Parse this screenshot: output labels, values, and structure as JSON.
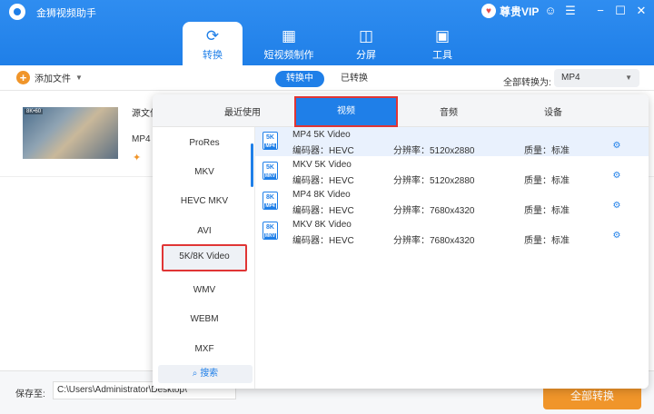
{
  "app": {
    "title": "金狮视频助手",
    "vip_label": "尊贵VIP"
  },
  "nav": {
    "tabs": [
      {
        "label": "转换",
        "icon": "convert-icon"
      },
      {
        "label": "短视频制作",
        "icon": "video-make-icon"
      },
      {
        "label": "分屏",
        "icon": "split-screen-icon"
      },
      {
        "label": "工具",
        "icon": "toolbox-icon"
      }
    ]
  },
  "toolbar": {
    "add_file": "添加文件",
    "seg_converting": "转换中",
    "seg_converted": "已转换",
    "convert_all_label": "全部转换为:",
    "convert_all_value": "MP4"
  },
  "file": {
    "source_label": "源文件",
    "format": "MP4",
    "thumb_tag": "8K•60"
  },
  "popup": {
    "categories": [
      "最近使用",
      "视频",
      "音频",
      "设备"
    ],
    "active_category": "视频",
    "formats": [
      "ProRes",
      "MKV",
      "HEVC MKV",
      "AVI",
      "5K/8K Video",
      "WMV",
      "WEBM",
      "MXF"
    ],
    "active_format": "5K/8K Video",
    "search_label": "搜索",
    "presets": [
      {
        "name": "MP4 5K Video",
        "badge": "5K",
        "badge_sub": "MP4",
        "codec": "编码器：HEVC",
        "res": "分辨率：5120x2880",
        "quality": "质量：标准"
      },
      {
        "name": "MKV 5K Video",
        "badge": "5K",
        "badge_sub": "MKV",
        "codec": "编码器：HEVC",
        "res": "分辨率：5120x2880",
        "quality": "质量：标准"
      },
      {
        "name": "MP4 8K Video",
        "badge": "8K",
        "badge_sub": "MP4",
        "codec": "编码器：HEVC",
        "res": "分辨率：7680x4320",
        "quality": "质量：标准"
      },
      {
        "name": "MKV 8K Video",
        "badge": "8K",
        "badge_sub": "MKV",
        "codec": "编码器：HEVC",
        "res": "分辨率：7680x4320",
        "quality": "质量：标准"
      }
    ]
  },
  "bottom": {
    "save_label": "保存至:",
    "save_path": "C:\\Users\\Administrator\\Desktop\\",
    "convert_all_btn": "全部转换"
  },
  "colors": {
    "primary": "#1f7fe8",
    "accent": "#f0952a",
    "highlight": "#e03535"
  }
}
